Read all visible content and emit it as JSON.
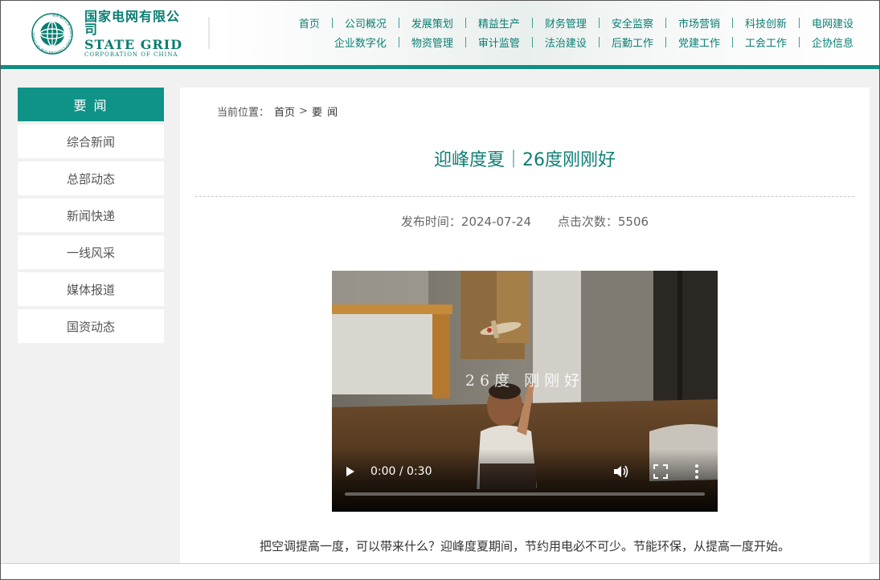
{
  "header": {
    "logo": {
      "cn": "国家电网有限公司",
      "en": "STATE GRID",
      "sub": "CORPORATION OF CHINA",
      "emblem_text": "国家电网公司 STATE GRID CORPORATION OF CHINA"
    },
    "nav_row1": [
      "首页",
      "公司概况",
      "发展策划",
      "精益生产",
      "财务管理",
      "安全监察",
      "市场营销",
      "科技创新",
      "电网建设"
    ],
    "nav_row2": [
      "企业数字化",
      "物资管理",
      "审计监管",
      "法治建设",
      "后勤工作",
      "党建工作",
      "工会工作",
      "企协信息"
    ]
  },
  "sidebar": {
    "heading": "要 闻",
    "items": [
      "综合新闻",
      "总部动态",
      "新闻快递",
      "一线风采",
      "媒体报道",
      "国资动态"
    ]
  },
  "breadcrumb": {
    "label": "当前位置：",
    "home": "首页",
    "separator": ">",
    "current": "要 闻"
  },
  "article": {
    "title": "迎峰度夏｜26度刚刚好",
    "publish_time": "发布时间：2024-07-24",
    "views": "点击次数：5506",
    "body": "把空调提高一度，可以带来什么？迎峰度夏期间，节约用电必不可少。节能环保，从提高一度开始。"
  },
  "video": {
    "caption": "26度  刚刚好",
    "time": "0:00 / 0:30",
    "progress": 0
  },
  "colors": {
    "accent": "#109387",
    "brand_text": "#0a7d72",
    "title": "#0f7f76"
  }
}
